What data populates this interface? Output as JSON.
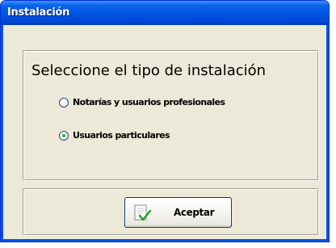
{
  "window": {
    "title": "Instalación"
  },
  "dialog": {
    "heading": "Seleccione el tipo de instalación",
    "options": [
      {
        "label": "Notarías y usuarios profesionales",
        "selected": false
      },
      {
        "label": "Usuarios particulares",
        "selected": true
      }
    ],
    "accept_button": {
      "label": "Aceptar",
      "icon": "document-check-icon"
    }
  },
  "colors": {
    "titlebar": "#0055e5",
    "window_bg": "#ece9d8",
    "radio_dot": "#3ba53b",
    "check_mark": "#2c9a2c"
  }
}
